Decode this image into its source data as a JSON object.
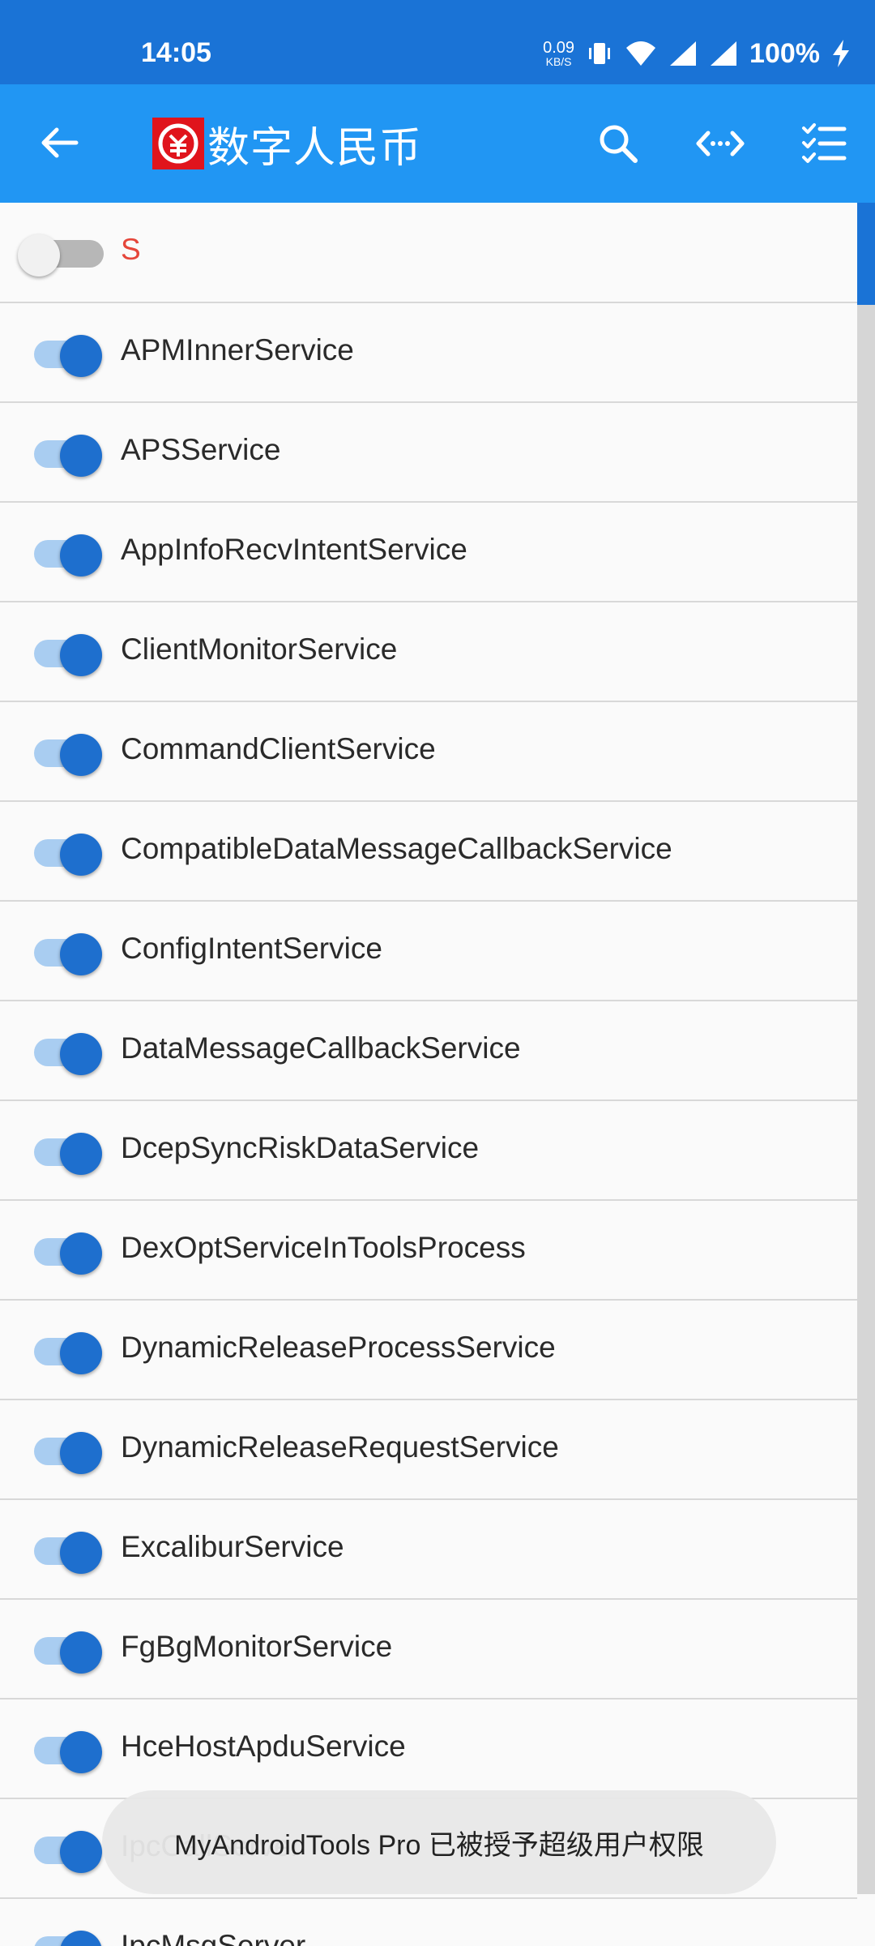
{
  "status_bar": {
    "time": "14:05",
    "net_speed_value": "0.09",
    "net_speed_unit": "KB/S",
    "battery": "100%",
    "icons": [
      "vibrate-icon",
      "wifi-icon",
      "signal-icon",
      "signal-icon",
      "charging-icon"
    ]
  },
  "app_bar": {
    "title": "数字人民币",
    "icons": [
      "back-arrow-icon",
      "search-icon",
      "code-icon",
      "checklist-icon"
    ],
    "colors": {
      "primary": "#2196f3",
      "status": "#1a73d6",
      "logo": "#e0141c"
    }
  },
  "list": {
    "header": {
      "label": "S",
      "enabled": false
    },
    "items": [
      {
        "label": "APMInnerService",
        "enabled": true
      },
      {
        "label": "APSService",
        "enabled": true
      },
      {
        "label": "AppInfoRecvIntentService",
        "enabled": true
      },
      {
        "label": "ClientMonitorService",
        "enabled": true
      },
      {
        "label": "CommandClientService",
        "enabled": true
      },
      {
        "label": "CompatibleDataMessageCallbackService",
        "enabled": true
      },
      {
        "label": "ConfigIntentService",
        "enabled": true
      },
      {
        "label": "DataMessageCallbackService",
        "enabled": true
      },
      {
        "label": "DcepSyncRiskDataService",
        "enabled": true
      },
      {
        "label": "DexOptServiceInToolsProcess",
        "enabled": true
      },
      {
        "label": "DynamicReleaseProcessService",
        "enabled": true
      },
      {
        "label": "DynamicReleaseRequestService",
        "enabled": true
      },
      {
        "label": "ExcaliburService",
        "enabled": true
      },
      {
        "label": "FgBgMonitorService",
        "enabled": true
      },
      {
        "label": "HceHostApduService",
        "enabled": true
      },
      {
        "label": "IpcCallServer",
        "enabled": true
      },
      {
        "label": "IpcMsgServer",
        "enabled": true
      }
    ]
  },
  "toast": {
    "text": "MyAndroidTools Pro 已被授予超级用户权限"
  }
}
